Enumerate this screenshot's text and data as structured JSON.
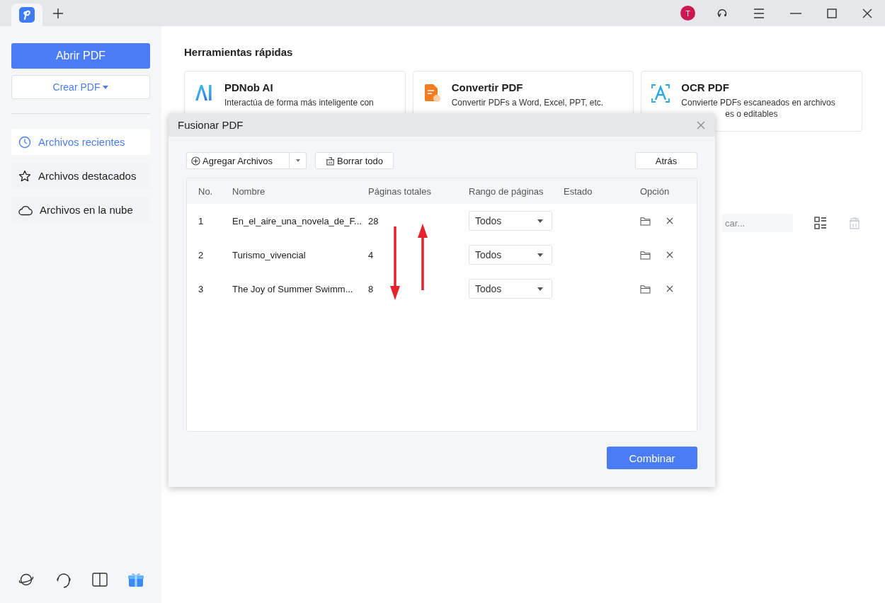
{
  "user": {
    "initial": "T"
  },
  "sidebar": {
    "primary_button": "Abrir PDF",
    "create_button": "Crear PDF",
    "items": [
      {
        "kind": "recent",
        "label": "Archivos recientes",
        "selected": true
      },
      {
        "kind": "starred",
        "label": "Archivos destacados",
        "selected": false
      },
      {
        "kind": "cloud",
        "label": "Archivos en la nube",
        "selected": false
      }
    ]
  },
  "quick_tools": {
    "title": "Herramientas rápidas",
    "cards": [
      {
        "kind": "ai",
        "title": "PDNob AI",
        "description": [
          "Interactúa de forma más inteligente con"
        ]
      },
      {
        "kind": "convert",
        "title": "Convertir PDF",
        "description": [
          "Convertir PDFs a Word, Excel, PPT, etc."
        ]
      },
      {
        "kind": "ocr",
        "title": "OCR PDF",
        "description": [
          "Convierte PDFs escaneados en archivos",
          "es o editables"
        ]
      }
    ]
  },
  "search": {
    "placeholder": "car..."
  },
  "dialog": {
    "title": "Fusionar PDF",
    "add_button": "Agregar Archivos",
    "clear_button": "Borrar todo",
    "back_button": "Atrás",
    "columns": [
      "No.",
      "Nombre",
      "Páginas totales",
      "Rango de páginas",
      "Estado",
      "Opción"
    ],
    "rows": [
      {
        "no": "1",
        "name": "En_el_aire_una_novela_de_F...",
        "pages": "28",
        "range": "Todos"
      },
      {
        "no": "2",
        "name": "Turismo_vivencial",
        "pages": "4",
        "range": "Todos"
      },
      {
        "no": "3",
        "name": "The Joy of Summer Swimm...",
        "pages": "8",
        "range": "Todos"
      }
    ],
    "combine_button": "Combinar"
  }
}
